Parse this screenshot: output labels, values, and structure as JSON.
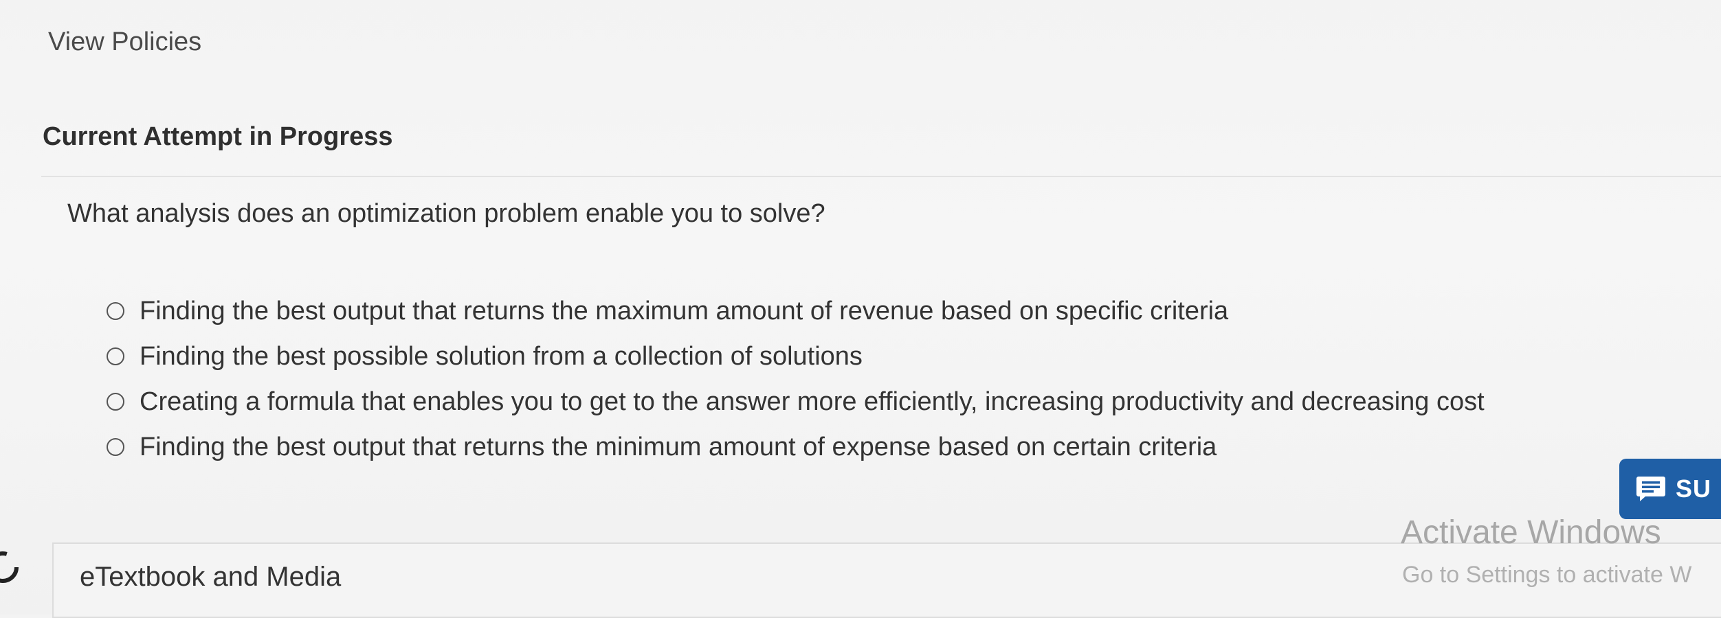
{
  "header": {
    "view_policies": "View Policies"
  },
  "attempt": {
    "title": "Current Attempt in Progress"
  },
  "question": {
    "text": "What analysis does an optimization problem enable you to solve?",
    "options": [
      "Finding the best output that returns the maximum amount of revenue based on specific criteria",
      "Finding the best possible solution from a collection of solutions",
      "Creating a formula that enables you to get to the answer more efficiently, increasing productivity and decreasing cost",
      "Finding the best output that returns the minimum amount of expense based on certain criteria"
    ]
  },
  "support": {
    "label": "SU",
    "icon": "chat-icon",
    "color": "#1f5fa6"
  },
  "resources": {
    "etextbook_label": "eTextbook and Media",
    "icon": "partial-circle-icon"
  },
  "windows_watermark": {
    "title": "Activate Windows",
    "subtitle": "Go to Settings to activate W"
  }
}
